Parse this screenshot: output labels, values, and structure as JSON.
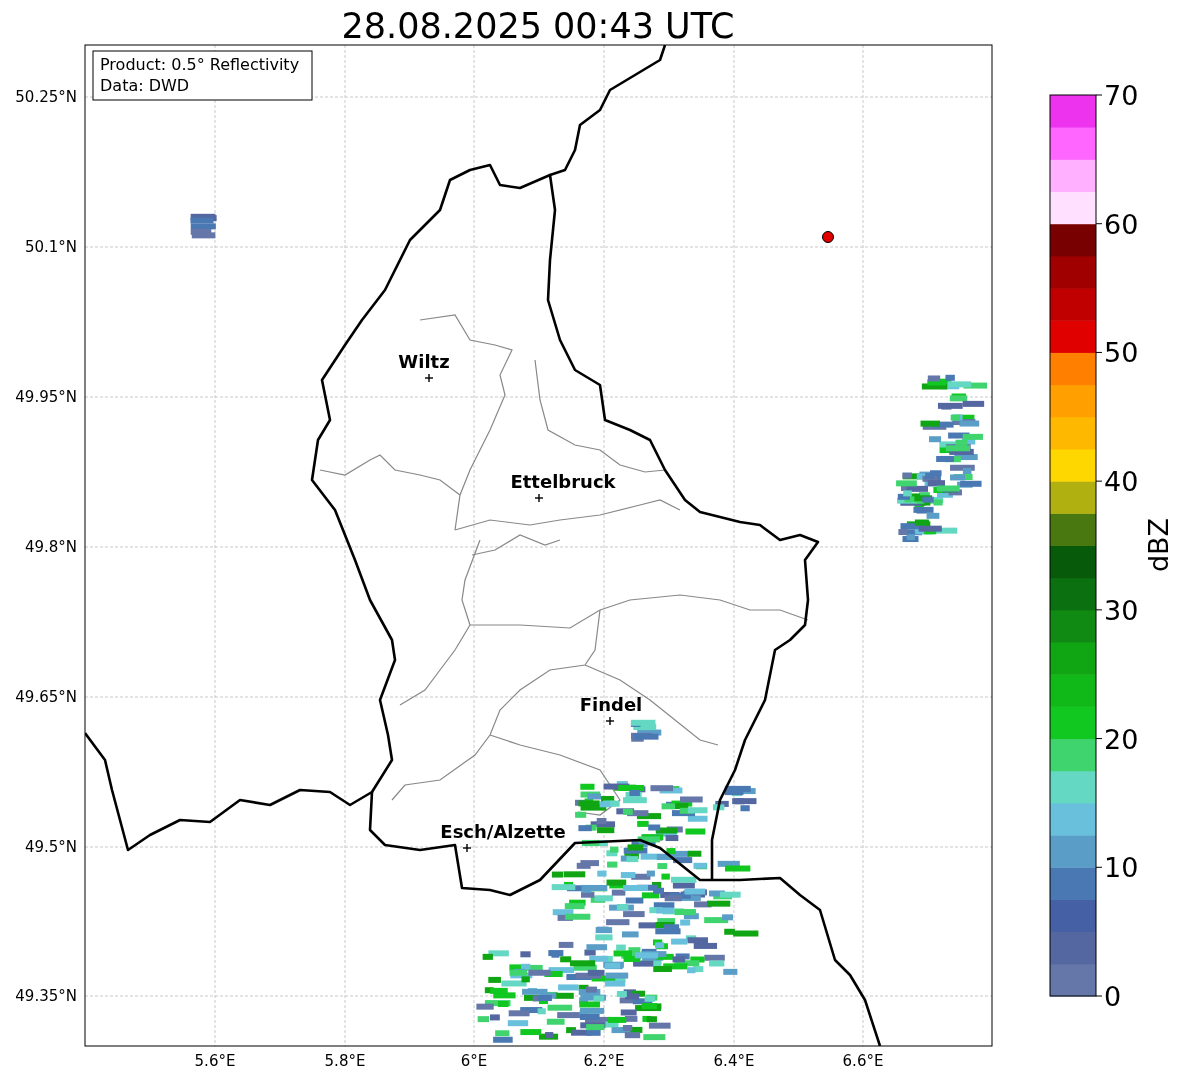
{
  "title": "28.08.2025 00:43 UTC",
  "legend": [
    "Product: 0.5° Reflectivity",
    "Data: DWD"
  ],
  "map": {
    "lat_labels": [
      "50.25°N",
      "50.1°N",
      "49.95°N",
      "49.8°N",
      "49.65°N",
      "49.5°N",
      "49.35°N"
    ],
    "lon_labels": [
      "5.6°E",
      "5.8°E",
      "6°E",
      "6.2°E",
      "6.4°E",
      "6.6°E"
    ],
    "cities": [
      {
        "name": "Wiltz"
      },
      {
        "name": "Ettelbruck"
      },
      {
        "name": "Findel"
      },
      {
        "name": "Esch/Alzette"
      }
    ]
  },
  "colorbar": {
    "label": "dBZ",
    "ticks": [
      "70",
      "60",
      "50",
      "40",
      "30",
      "20",
      "10",
      "0"
    ],
    "segments": [
      {
        "color": "#6477a8"
      },
      {
        "color": "#5567a0"
      },
      {
        "color": "#4560a5"
      },
      {
        "color": "#4a78b3"
      },
      {
        "color": "#5a9ec8"
      },
      {
        "color": "#68c0dc"
      },
      {
        "color": "#64d8c2"
      },
      {
        "color": "#3fd46e"
      },
      {
        "color": "#10c820"
      },
      {
        "color": "#10b818"
      },
      {
        "color": "#10a512"
      },
      {
        "color": "#108a12"
      },
      {
        "color": "#0a7010"
      },
      {
        "color": "#065a0a"
      },
      {
        "color": "#4a7810"
      },
      {
        "color": "#b0b010"
      },
      {
        "color": "#ffd700"
      },
      {
        "color": "#ffb800"
      },
      {
        "color": "#ff9f00"
      },
      {
        "color": "#ff8000"
      },
      {
        "color": "#e00000"
      },
      {
        "color": "#c00000"
      },
      {
        "color": "#a00000"
      },
      {
        "color": "#780000"
      },
      {
        "color": "#ffe0ff"
      },
      {
        "color": "#ffb0ff"
      },
      {
        "color": "#ff66ff"
      },
      {
        "color": "#ee33ee"
      }
    ]
  }
}
